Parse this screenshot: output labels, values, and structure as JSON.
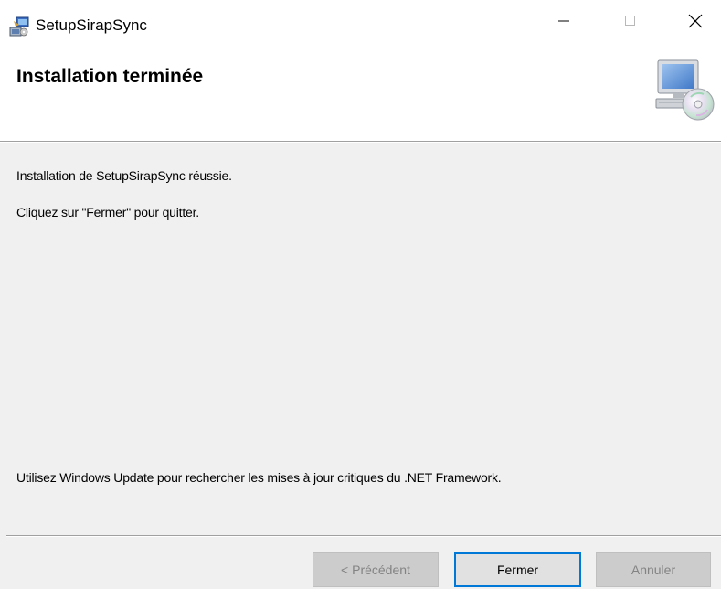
{
  "window": {
    "title": "SetupSirapSync",
    "app_icon": "installer-icon",
    "controls": {
      "minimize_icon": "minimize-icon",
      "maximize_icon": "maximize-icon",
      "close_icon": "close-icon"
    }
  },
  "banner": {
    "title": "Installation terminée",
    "art_icon": "computer-cd-icon"
  },
  "body": {
    "line1": "Installation de SetupSirapSync réussie.",
    "line2": "Cliquez sur \"Fermer\" pour quitter.",
    "line3": "Utilisez Windows Update pour rechercher les mises à jour critiques du .NET Framework."
  },
  "buttons": {
    "previous": {
      "label": "< Précédent",
      "enabled": false
    },
    "close": {
      "label": "Fermer",
      "enabled": true,
      "default": true
    },
    "cancel": {
      "label": "Annuler",
      "enabled": false
    }
  },
  "colors": {
    "accent": "#0078d7",
    "dialog_background": "#f0f0f0",
    "disabled_text": "#838383"
  }
}
